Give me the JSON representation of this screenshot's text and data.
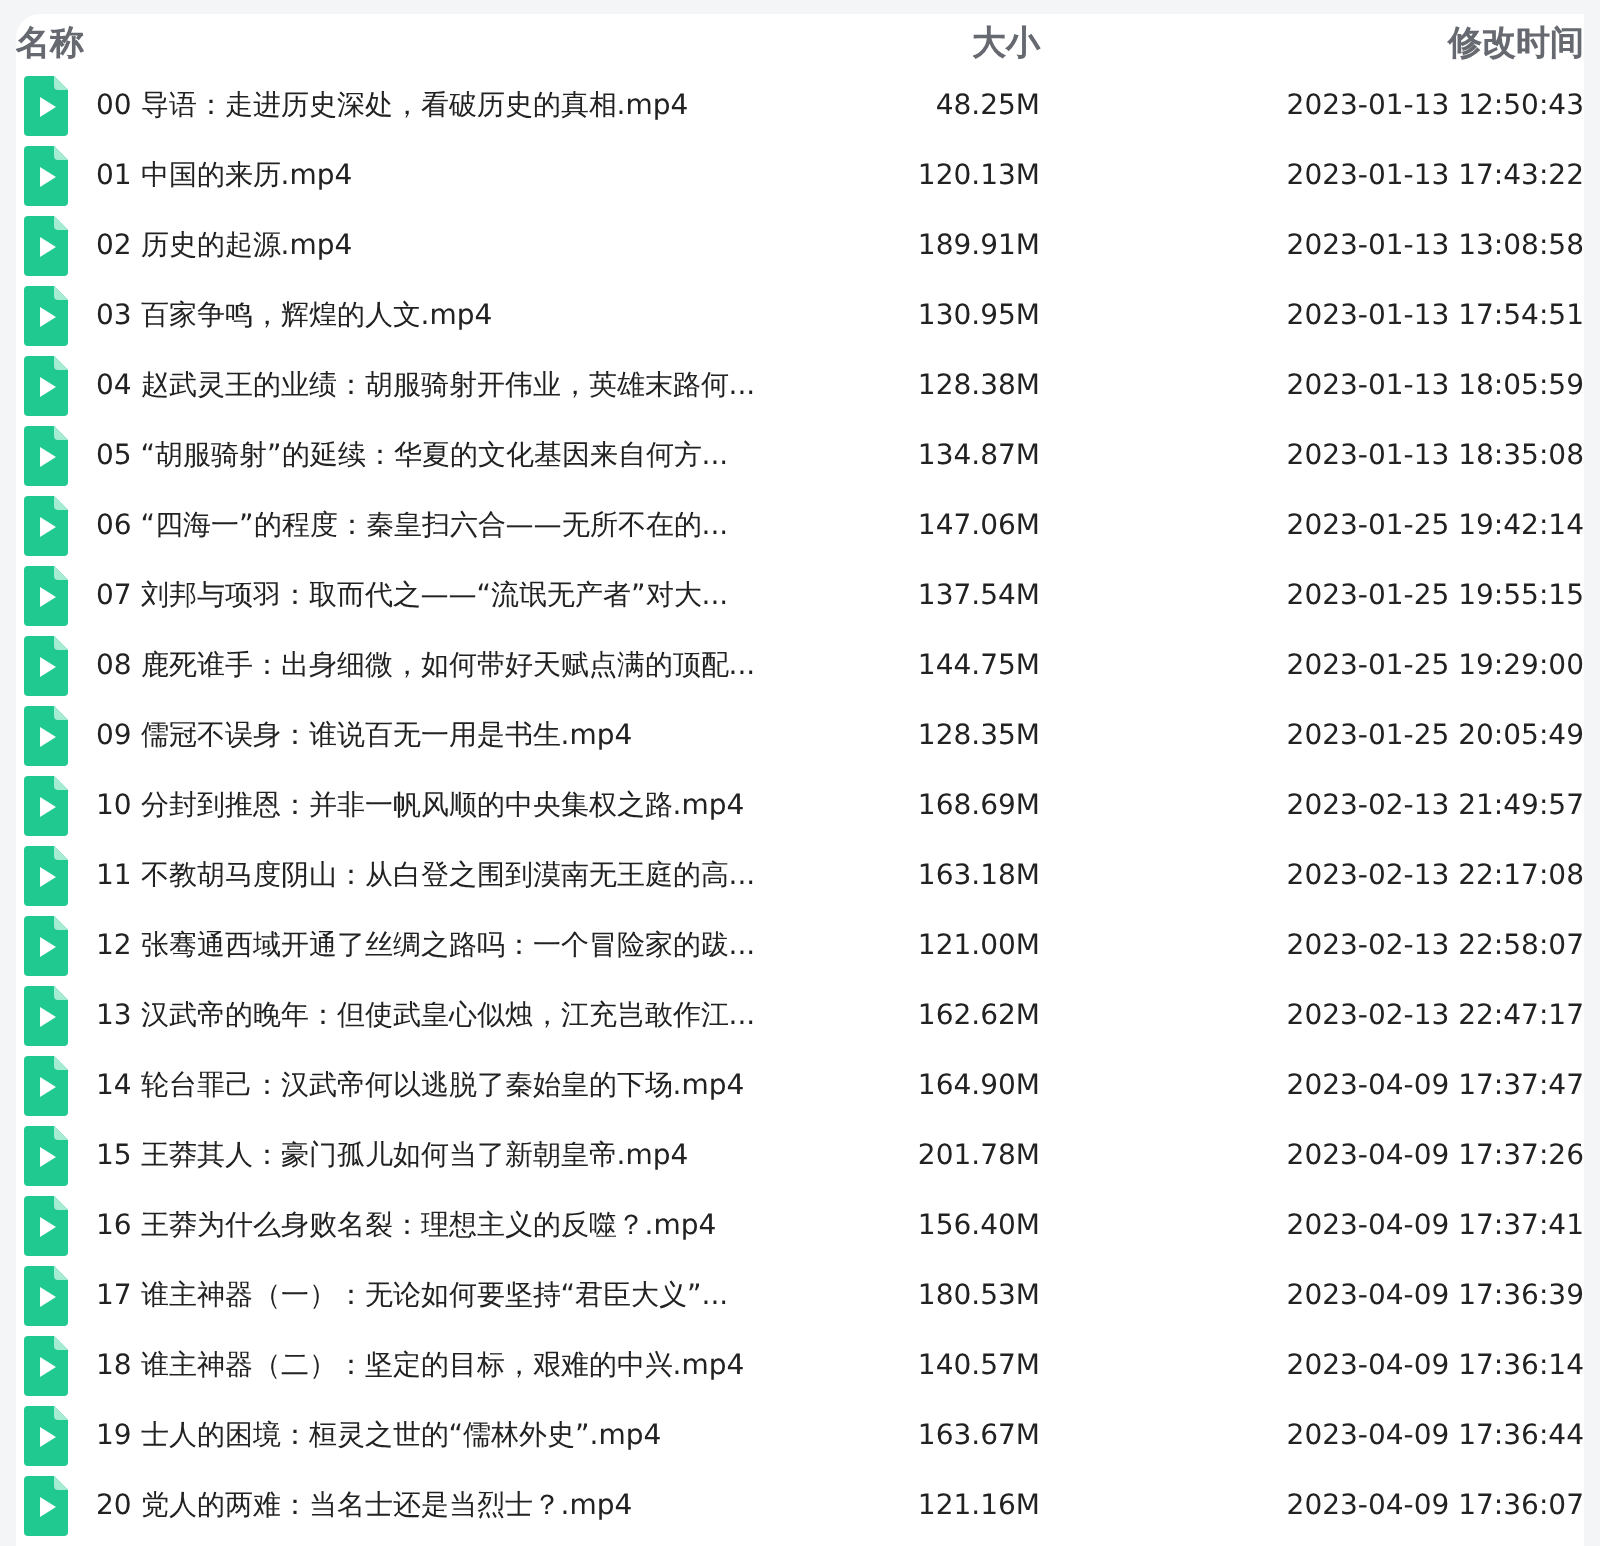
{
  "columns": [
    {
      "label": "名称"
    },
    {
      "label": "大小"
    },
    {
      "label": "修改时间"
    }
  ],
  "files": [
    {
      "name": "00 导语：走进历史深处，看破历史的真相.mp4",
      "size": "48.25M",
      "modified": "2023-01-13 12:50:43"
    },
    {
      "name": "01 中国的来历.mp4",
      "size": "120.13M",
      "modified": "2023-01-13 17:43:22"
    },
    {
      "name": "02 历史的起源.mp4",
      "size": "189.91M",
      "modified": "2023-01-13 13:08:58"
    },
    {
      "name": "03 百家争鸣，辉煌的人文.mp4",
      "size": "130.95M",
      "modified": "2023-01-13 17:54:51"
    },
    {
      "name": "04 赵武灵王的业绩：胡服骑射开伟业，英雄末路何...",
      "size": "128.38M",
      "modified": "2023-01-13 18:05:59"
    },
    {
      "name": "05 “胡服骑射”的延续：华夏的文化基因来自何方...",
      "size": "134.87M",
      "modified": "2023-01-13 18:35:08"
    },
    {
      "name": "06 “四海一”的程度：秦皇扫六合——无所不在的...",
      "size": "147.06M",
      "modified": "2023-01-25 19:42:14"
    },
    {
      "name": "07 刘邦与项羽：取而代之——“流氓无产者”对大...",
      "size": "137.54M",
      "modified": "2023-01-25 19:55:15"
    },
    {
      "name": "08 鹿死谁手：出身细微，如何带好天赋点满的顶配...",
      "size": "144.75M",
      "modified": "2023-01-25 19:29:00"
    },
    {
      "name": "09 儒冠不误身：谁说百无一用是书生.mp4",
      "size": "128.35M",
      "modified": "2023-01-25 20:05:49"
    },
    {
      "name": "10 分封到推恩：并非一帆风顺的中央集权之路.mp4",
      "size": "168.69M",
      "modified": "2023-02-13 21:49:57"
    },
    {
      "name": "11 不教胡马度阴山：从白登之围到漠南无王庭的高...",
      "size": "163.18M",
      "modified": "2023-02-13 22:17:08"
    },
    {
      "name": "12 张骞通西域开通了丝绸之路吗：一个冒险家的跋...",
      "size": "121.00M",
      "modified": "2023-02-13 22:58:07"
    },
    {
      "name": "13 汉武帝的晚年：但使武皇心似烛，江充岂敢作江...",
      "size": "162.62M",
      "modified": "2023-02-13 22:47:17"
    },
    {
      "name": "14 轮台罪己：汉武帝何以逃脱了秦始皇的下场.mp4",
      "size": "164.90M",
      "modified": "2023-04-09 17:37:47"
    },
    {
      "name": "15 王莽其人：豪门孤儿如何当了新朝皇帝.mp4",
      "size": "201.78M",
      "modified": "2023-04-09 17:37:26"
    },
    {
      "name": "16 王莽为什么身败名裂：理想主义的反噬？.mp4",
      "size": "156.40M",
      "modified": "2023-04-09 17:37:41"
    },
    {
      "name": "17 谁主神器（一）：无论如何要坚持“君臣大义”...",
      "size": "180.53M",
      "modified": "2023-04-09 17:36:39"
    },
    {
      "name": "18 谁主神器（二）：坚定的目标，艰难的中兴.mp4",
      "size": "140.57M",
      "modified": "2023-04-09 17:36:14"
    },
    {
      "name": "19 士人的困境：桓灵之世的“儒林外史”.mp4",
      "size": "163.67M",
      "modified": "2023-04-09 17:36:44"
    },
    {
      "name": "20 党人的两难：当名士还是当烈士？.mp4",
      "size": "121.16M",
      "modified": "2023-04-09 17:36:07"
    }
  ]
}
